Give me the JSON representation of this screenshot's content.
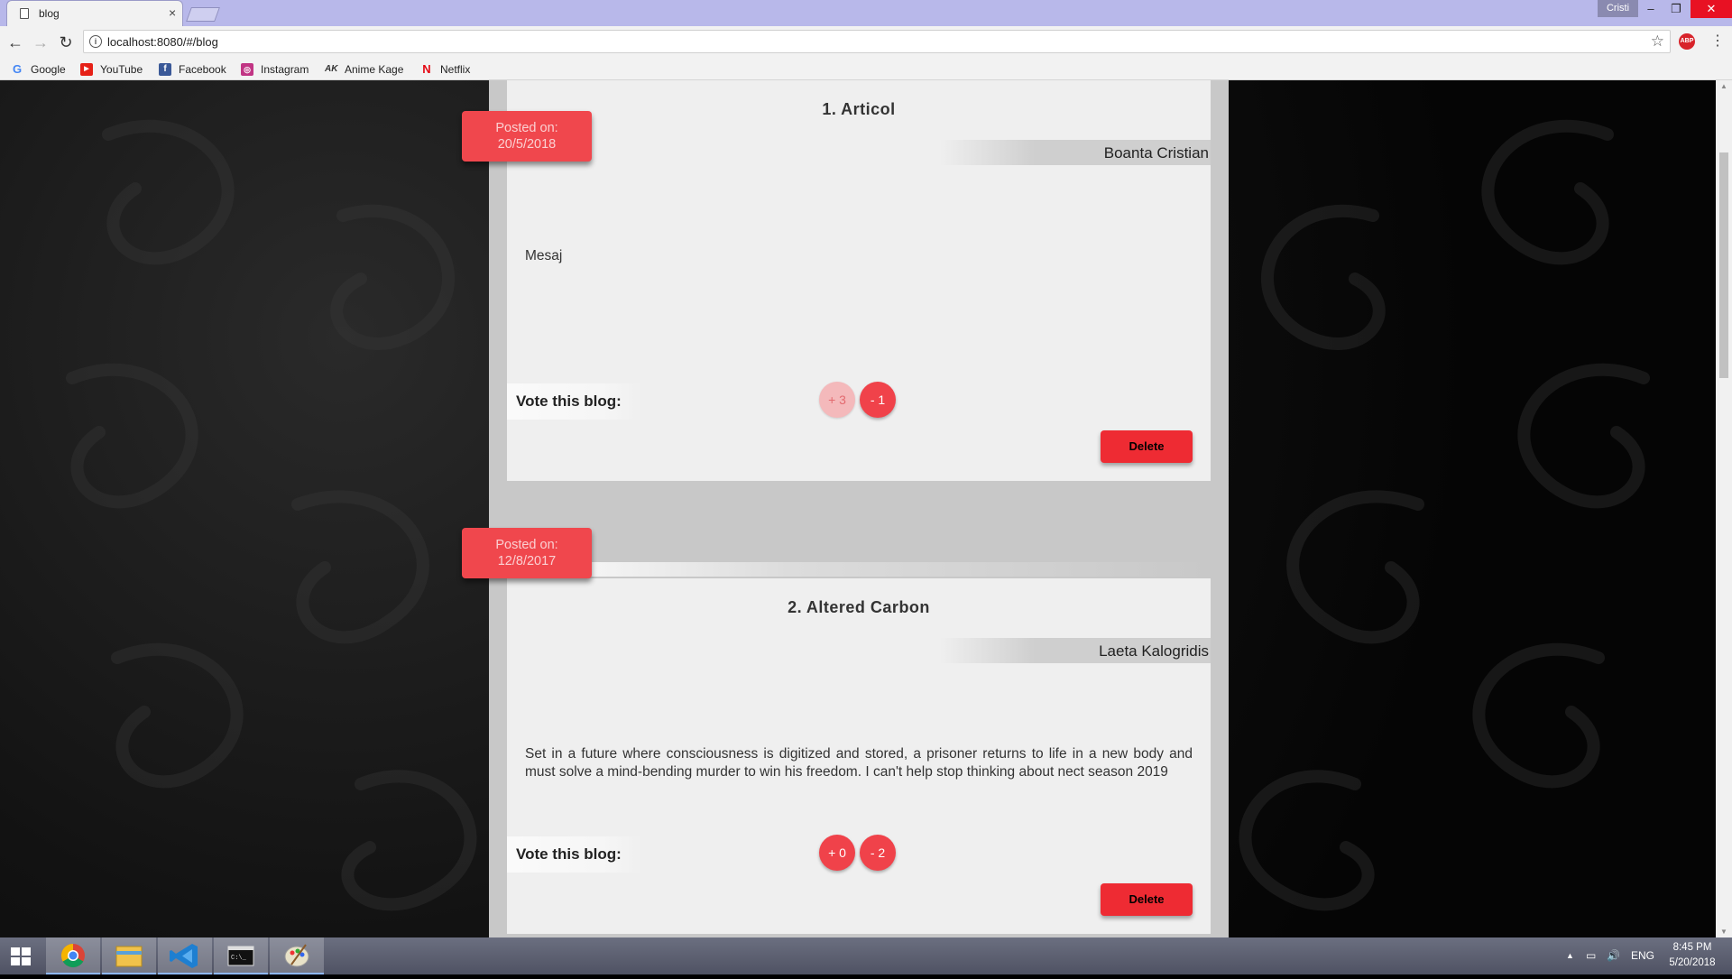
{
  "browser": {
    "tab_title": "blog",
    "url": "localhost:8080/#/blog",
    "profile_name": "Cristi",
    "bookmarks": [
      {
        "label": "Google",
        "icon": "google-icon"
      },
      {
        "label": "YouTube",
        "icon": "youtube-icon"
      },
      {
        "label": "Facebook",
        "icon": "facebook-icon"
      },
      {
        "label": "Instagram",
        "icon": "instagram-icon"
      },
      {
        "label": "Anime Kage",
        "icon": "animekage-icon"
      },
      {
        "label": "Netflix",
        "icon": "netflix-icon"
      }
    ]
  },
  "posts": [
    {
      "title": "1. Articol",
      "author": "Boanta Cristian",
      "posted_label": "Posted on:",
      "posted_date": "20/5/2018",
      "message": "Mesaj",
      "vote_label": "Vote this blog:",
      "upvote": "+ 3",
      "downvote": "- 1",
      "delete_label": "Delete"
    },
    {
      "title": "2. Altered Carbon",
      "author": "Laeta Kalogridis",
      "posted_label": "Posted on:",
      "posted_date": "12/8/2017",
      "message": "Set in a future where consciousness is digitized and stored, a prisoner returns to life in a new body and must solve a mind-bending murder to win his freedom. I can't help stop thinking about nect season 2019",
      "vote_label": "Vote this blog:",
      "upvote": "+ 0",
      "downvote": "- 2",
      "delete_label": "Delete"
    }
  ],
  "taskbar": {
    "language": "ENG",
    "time": "8:45 PM",
    "date": "5/20/2018",
    "apps": [
      "windows-start-icon",
      "chrome-icon",
      "file-explorer-icon",
      "vscode-icon",
      "cmd-icon",
      "paint-icon"
    ]
  },
  "colors": {
    "accent_red": "#f0424a",
    "titlebar": "#b8b8ea",
    "card_bg": "#efefef"
  }
}
